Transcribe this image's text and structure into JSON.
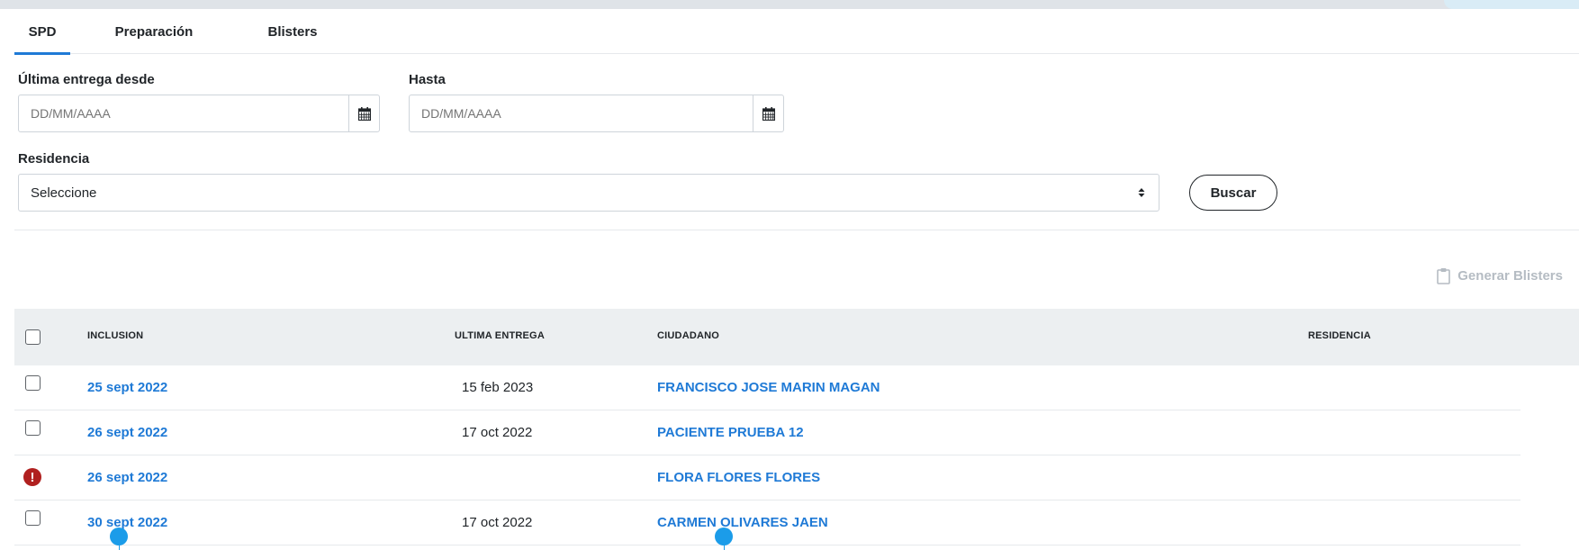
{
  "tabs": [
    {
      "label": "SPD",
      "active": true
    },
    {
      "label": "Preparación",
      "active": false
    },
    {
      "label": "Blisters",
      "active": false
    }
  ],
  "filters": {
    "desde_label": "Última entrega desde",
    "desde_placeholder": "DD/MM/AAAA",
    "hasta_label": "Hasta",
    "hasta_placeholder": "DD/MM/AAAA",
    "residencia_label": "Residencia",
    "residencia_value": "Seleccione",
    "search_label": "Buscar"
  },
  "actions": {
    "generate_label": "Generar Blisters"
  },
  "table": {
    "headers": [
      "INCLUSION",
      "ULTIMA ENTREGA",
      "CIUDADANO",
      "RESIDENCIA"
    ],
    "rows": [
      {
        "inclusion": "25 sept 2022",
        "ultima_entrega": "15 feb 2023",
        "ciudadano": "FRANCISCO JOSE MARIN MAGAN",
        "residencia": "",
        "status": "checkbox"
      },
      {
        "inclusion": "26 sept 2022",
        "ultima_entrega": "17 oct 2022",
        "ciudadano": "PACIENTE PRUEBA 12",
        "residencia": "",
        "status": "checkbox"
      },
      {
        "inclusion": "26 sept 2022",
        "ultima_entrega": "",
        "ciudadano": "FLORA FLORES FLORES",
        "residencia": "",
        "status": "error"
      },
      {
        "inclusion": "30 sept 2022",
        "ultima_entrega": "17 oct 2022",
        "ciudadano": "CARMEN OLIVARES JAEN",
        "residencia": "",
        "status": "checkbox"
      }
    ]
  },
  "colors": {
    "accent": "#1f7ad6",
    "error": "#b0201f",
    "cursor_marker": "#1b9ce9",
    "header_bg": "#eceff1"
  },
  "icons": {
    "date_picker": "calendar-icon",
    "select": "sort-arrows-icon",
    "generate": "clipboard-icon",
    "row_error": "exclamation-circle-icon"
  }
}
